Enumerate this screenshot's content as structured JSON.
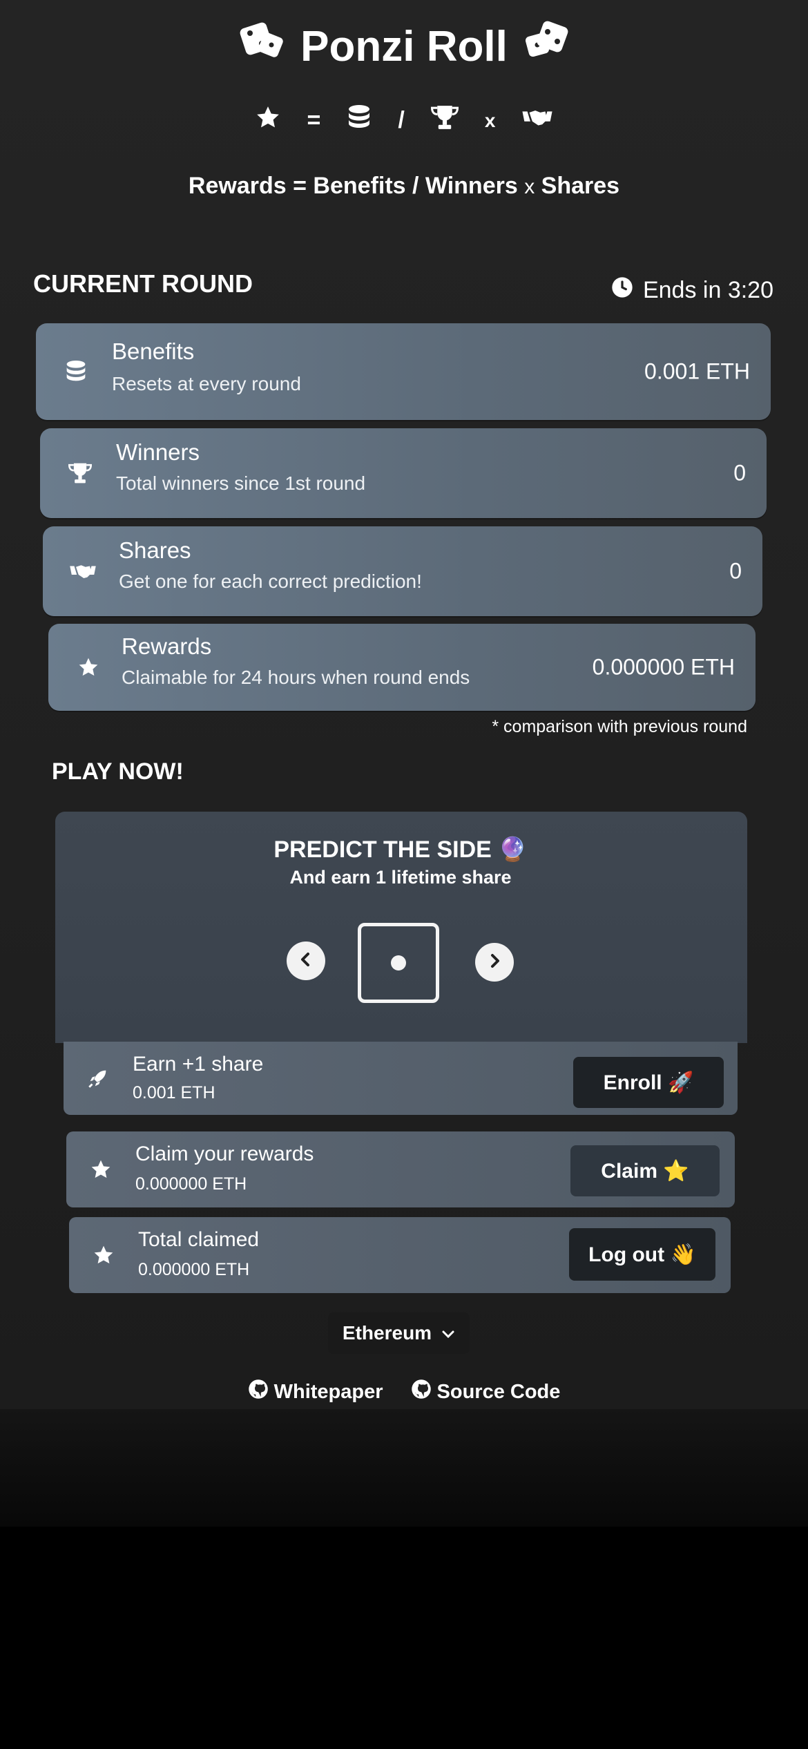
{
  "app": {
    "title": "Ponzi Roll",
    "formula_symbols": {
      "equals": "=",
      "divide": "/",
      "times": "x"
    },
    "formula_text": {
      "rewards": "Rewards",
      "eq": "=",
      "benefits": "Benefits",
      "div": "/",
      "winners": "Winners",
      "times": "x",
      "shares": "Shares"
    }
  },
  "current_round": {
    "heading": "CURRENT ROUND",
    "ends_in": "Ends in 3:20",
    "stats": [
      {
        "icon": "coins-icon",
        "label": "Benefits",
        "sub": "Resets at every round",
        "value": "0.001 ETH"
      },
      {
        "icon": "trophy-icon",
        "label": "Winners",
        "sub": "Total winners since 1st round",
        "value": "0"
      },
      {
        "icon": "handshake-icon",
        "label": "Shares",
        "sub": "Get one for each correct prediction!",
        "value": "0"
      },
      {
        "icon": "star-icon",
        "label": "Rewards",
        "sub": "Claimable for 24 hours when round ends",
        "value": "0.000000 ETH"
      }
    ],
    "note": "* comparison with previous round"
  },
  "play": {
    "heading": "PLAY NOW!",
    "predict_title": "PREDICT THE SIDE 🔮",
    "predict_sub": "And earn 1 lifetime share",
    "die_face": 1,
    "actions": [
      {
        "icon": "rocket-icon",
        "label": "Earn +1 share",
        "sub": "0.001 ETH",
        "button": "Enroll 🚀"
      },
      {
        "icon": "star-icon",
        "label": "Claim your rewards",
        "sub": "0.000000 ETH",
        "button": "Claim ⭐"
      },
      {
        "icon": "star-icon",
        "label": "Total claimed",
        "sub": "0.000000 ETH",
        "button": "Log out 👋"
      }
    ]
  },
  "footer": {
    "network": "Ethereum",
    "links": {
      "whitepaper": "Whitepaper",
      "source": "Source Code"
    }
  },
  "colors": {
    "background": "#222222",
    "card": "#65768a",
    "button": "#1e2226"
  }
}
